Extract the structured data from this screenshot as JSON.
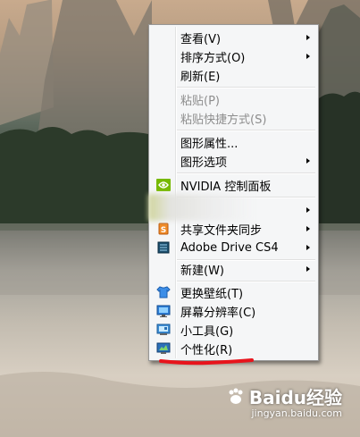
{
  "context_menu": {
    "items": [
      {
        "label": "查看(V)",
        "submenu": true,
        "disabled": false
      },
      {
        "label": "排序方式(O)",
        "submenu": true,
        "disabled": false
      },
      {
        "label": "刷新(E)",
        "submenu": false,
        "disabled": false
      },
      {
        "label": "粘贴(P)",
        "submenu": false,
        "disabled": true
      },
      {
        "label": "粘贴快捷方式(S)",
        "submenu": false,
        "disabled": true
      },
      {
        "label": "图形属性...",
        "submenu": false,
        "disabled": false
      },
      {
        "label": "图形选项",
        "submenu": true,
        "disabled": false
      },
      {
        "label": "NVIDIA 控制面板",
        "submenu": false,
        "disabled": false,
        "icon": "nvidia-icon"
      },
      {
        "label": "",
        "submenu": true,
        "disabled": false,
        "note": "blurred-item"
      },
      {
        "label": "共享文件夹同步",
        "submenu": true,
        "disabled": false,
        "icon": "sync-share-icon"
      },
      {
        "label": "Adobe Drive CS4",
        "submenu": true,
        "disabled": false,
        "icon": "adobe-drive-icon"
      },
      {
        "label": "新建(W)",
        "submenu": true,
        "disabled": false
      },
      {
        "label": "更换壁纸(T)",
        "submenu": false,
        "disabled": false,
        "icon": "wallpaper-shirt-icon"
      },
      {
        "label": "屏幕分辨率(C)",
        "submenu": false,
        "disabled": false,
        "icon": "display-icon"
      },
      {
        "label": "小工具(G)",
        "submenu": false,
        "disabled": false,
        "icon": "gadgets-icon"
      },
      {
        "label": "个性化(R)",
        "submenu": false,
        "disabled": false,
        "icon": "personalize-icon"
      }
    ]
  },
  "annotation": {
    "color": "#e8141c"
  },
  "watermark": {
    "brand": "Baidu经验",
    "url": "jingyan.baidu.com"
  }
}
